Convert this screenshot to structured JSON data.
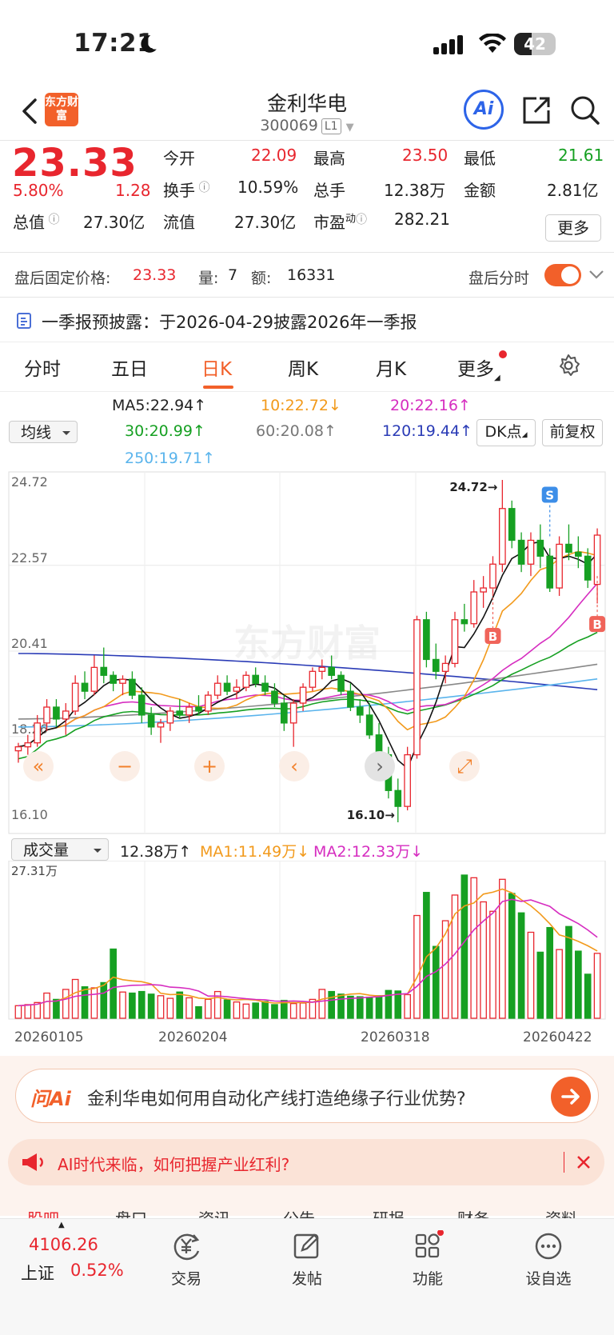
{
  "status": {
    "time": "17:21",
    "battery": "42",
    "battery_level": 0.42
  },
  "header": {
    "name": "金利华电",
    "code": "300069",
    "level_tag": "L1",
    "logo_text": "东方财富",
    "ai_label": "Ai"
  },
  "quote": {
    "price": "23.33",
    "pct": "5.80%",
    "change": "1.28",
    "open_label": "今开",
    "open": "22.09",
    "high_label": "最高",
    "high": "23.50",
    "low_label": "最低",
    "low": "21.61",
    "turnover_label": "换手",
    "turnover": "10.59%",
    "volume_label": "总手",
    "volume": "12.38万",
    "amount_label": "金额",
    "amount": "2.81亿",
    "mktcap_label": "总值",
    "mktcap": "27.30亿",
    "float_label": "流值",
    "float_cap": "27.30亿",
    "pe_label": "市盈",
    "pe_sup": "动",
    "pe": "282.21",
    "more_label": "更多"
  },
  "after_hours": {
    "price_label": "盘后固定价格:",
    "price": "23.33",
    "vol_label": "量:",
    "vol": "7",
    "amt_label": "额:",
    "amt": "16331",
    "toggle_label": "盘后分时"
  },
  "notice": {
    "text": "一季报预披露：于2026-04-29披露2026年一季报"
  },
  "tabs": [
    "分时",
    "五日",
    "日K",
    "周K",
    "月K",
    "更多"
  ],
  "active_tab": 2,
  "ma": {
    "selector": "均线",
    "ma5": "MA5:22.94",
    "ma10": "10:22.72",
    "ma20": "20:22.16",
    "ma30": "30:20.99",
    "ma60": "60:20.08",
    "ma120": "120:19.44",
    "ma250": "250:19.71",
    "dk_label": "DK点",
    "fq_label": "前复权"
  },
  "chart_data": [
    {
      "type": "candlestick",
      "ylim": [
        16.1,
        24.72
      ],
      "y_ticks": [
        "24.72",
        "22.57",
        "20.41",
        "18.26",
        "16.10"
      ],
      "annotations": {
        "high": "24.72",
        "low": "16.10",
        "sell_marker": "S",
        "buy_marker": "B"
      },
      "watermark": "东方财富",
      "candles": [
        [
          17.9,
          18.1,
          17.6,
          18.0
        ],
        [
          18.0,
          18.3,
          17.8,
          18.1
        ],
        [
          18.1,
          18.8,
          18.0,
          18.6
        ],
        [
          18.6,
          19.2,
          18.4,
          19.0
        ],
        [
          19.0,
          19.2,
          18.5,
          18.7
        ],
        [
          18.7,
          19.1,
          18.3,
          18.9
        ],
        [
          18.9,
          19.8,
          18.8,
          19.6
        ],
        [
          19.6,
          19.9,
          19.2,
          19.4
        ],
        [
          19.4,
          20.3,
          19.3,
          20.0
        ],
        [
          20.0,
          20.5,
          19.6,
          19.8
        ],
        [
          19.8,
          19.9,
          19.4,
          19.6
        ],
        [
          19.6,
          19.8,
          19.3,
          19.7
        ],
        [
          19.7,
          19.9,
          19.2,
          19.3
        ],
        [
          19.3,
          19.5,
          18.6,
          18.8
        ],
        [
          18.8,
          19.0,
          18.3,
          18.5
        ],
        [
          18.5,
          18.7,
          18.1,
          18.6
        ],
        [
          18.6,
          19.0,
          18.4,
          18.9
        ],
        [
          18.9,
          19.2,
          18.7,
          18.8
        ],
        [
          18.8,
          19.1,
          18.6,
          19.0
        ],
        [
          19.0,
          19.3,
          18.8,
          18.9
        ],
        [
          18.9,
          19.4,
          18.8,
          19.3
        ],
        [
          19.3,
          19.8,
          19.2,
          19.6
        ],
        [
          19.6,
          19.8,
          19.3,
          19.4
        ],
        [
          19.4,
          19.7,
          19.2,
          19.5
        ],
        [
          19.5,
          19.9,
          19.4,
          19.8
        ],
        [
          19.8,
          20.0,
          19.5,
          19.6
        ],
        [
          19.6,
          19.8,
          19.3,
          19.4
        ],
        [
          19.4,
          19.6,
          19.0,
          19.1
        ],
        [
          19.1,
          19.3,
          18.4,
          18.6
        ],
        [
          18.6,
          19.2,
          18.0,
          19.1
        ],
        [
          19.1,
          19.6,
          18.9,
          19.5
        ],
        [
          19.5,
          20.0,
          19.4,
          19.9
        ],
        [
          19.9,
          20.2,
          19.7,
          20.0
        ],
        [
          20.0,
          20.3,
          19.7,
          19.8
        ],
        [
          19.8,
          19.9,
          19.3,
          19.4
        ],
        [
          19.4,
          19.6,
          18.9,
          19.0
        ],
        [
          19.0,
          19.2,
          18.6,
          18.8
        ],
        [
          18.8,
          19.1,
          18.2,
          18.3
        ],
        [
          18.3,
          18.6,
          17.7,
          17.8
        ],
        [
          17.8,
          18.0,
          16.7,
          16.9
        ],
        [
          16.9,
          17.2,
          16.1,
          16.5
        ],
        [
          16.5,
          18.0,
          16.4,
          17.8
        ],
        [
          17.8,
          21.3,
          17.7,
          21.2
        ],
        [
          21.2,
          21.4,
          20.0,
          20.2
        ],
        [
          20.2,
          20.6,
          19.7,
          19.9
        ],
        [
          19.9,
          20.3,
          19.6,
          20.1
        ],
        [
          20.1,
          21.4,
          20.0,
          21.2
        ],
        [
          21.2,
          21.6,
          20.9,
          21.1
        ],
        [
          21.1,
          22.2,
          21.0,
          21.9
        ],
        [
          21.9,
          22.3,
          21.5,
          22.0
        ],
        [
          22.0,
          22.8,
          21.8,
          22.6
        ],
        [
          22.6,
          24.72,
          22.4,
          24.0
        ],
        [
          24.0,
          24.2,
          23.0,
          23.2
        ],
        [
          23.2,
          23.4,
          22.4,
          22.6
        ],
        [
          22.6,
          23.4,
          22.3,
          23.2
        ],
        [
          23.2,
          23.6,
          22.5,
          22.8
        ],
        [
          22.8,
          23.0,
          21.9,
          22.0
        ],
        [
          22.0,
          23.3,
          21.8,
          23.1
        ],
        [
          23.1,
          23.6,
          22.7,
          22.9
        ],
        [
          22.9,
          23.3,
          22.5,
          22.8
        ],
        [
          22.8,
          23.0,
          22.0,
          22.2
        ],
        [
          22.09,
          23.5,
          21.61,
          23.33
        ]
      ]
    },
    {
      "type": "bar",
      "selector": "成交量",
      "label_volume": "12.38万",
      "label_ma1": "MA1:11.49万",
      "label_ma2": "MA2:12.33万",
      "ymax_label": "27.31万",
      "ymax": 27.31,
      "x_ticks": [
        "20260105",
        "20260204",
        "20260318",
        "20260422"
      ],
      "values": [
        2.4,
        2.6,
        3.0,
        4.8,
        3.6,
        5.5,
        7.4,
        6.0,
        5.8,
        6.8,
        13.2,
        5.0,
        4.8,
        5.1,
        4.6,
        4.3,
        3.8,
        5.0,
        3.9,
        2.2,
        3.6,
        5.1,
        3.5,
        3.1,
        2.7,
        2.9,
        3.2,
        2.6,
        3.4,
        2.8,
        2.9,
        3.6,
        5.5,
        5.1,
        4.6,
        4.2,
        4.1,
        4.0,
        4.3,
        5.3,
        5.2,
        4.5,
        19.6,
        24.0,
        13.7,
        18.6,
        23.5,
        27.31,
        26.8,
        22.2,
        20.4,
        26.5,
        23.8,
        20.1,
        16.4,
        12.6,
        17.3,
        13.1,
        17.5,
        12.8,
        8.4,
        12.38
      ]
    }
  ],
  "ai_question": {
    "badge": "问Ai",
    "text": "金利华电如何用自动化产线打造绝缘子行业优势?"
  },
  "promo": {
    "text": "AI时代来临，如何把握产业红利?"
  },
  "sub_tabs": [
    "股吧",
    "盘口",
    "资讯",
    "公告",
    "研报",
    "财务",
    "资料"
  ],
  "bottom_nav": {
    "index_value": "4106.26",
    "index_name": "上证",
    "index_pct": "0.52%",
    "items": [
      "交易",
      "发帖",
      "功能",
      "设自选"
    ]
  }
}
